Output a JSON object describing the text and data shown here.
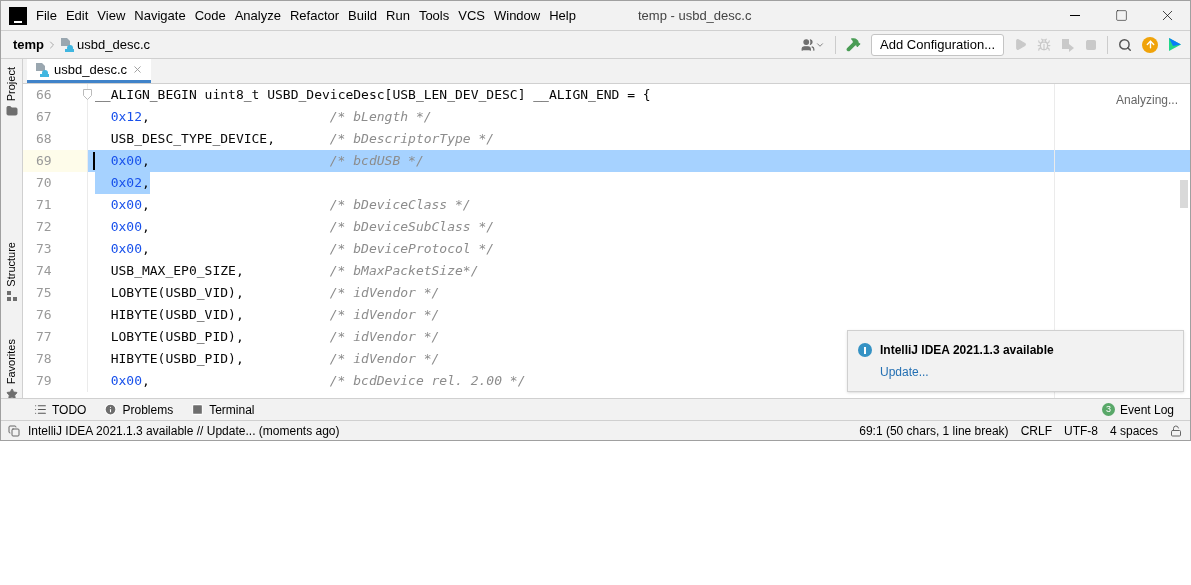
{
  "window": {
    "title": "temp - usbd_desc.c"
  },
  "menu": [
    "File",
    "Edit",
    "View",
    "Navigate",
    "Code",
    "Analyze",
    "Refactor",
    "Build",
    "Run",
    "Tools",
    "VCS",
    "Window",
    "Help"
  ],
  "breadcrumb": [
    "temp",
    "usbd_desc.c"
  ],
  "toolbar": {
    "config_button": "Add Configuration..."
  },
  "side_tabs": [
    {
      "label": "Project",
      "kind": "folder"
    },
    {
      "label": "Structure",
      "kind": "structure"
    },
    {
      "label": "Favorites",
      "kind": "star"
    }
  ],
  "editor_tabs": [
    {
      "label": "usbd_desc.c",
      "selected": true
    }
  ],
  "editor": {
    "status": "Analyzing...",
    "lines": [
      {
        "number": "66",
        "indented": false,
        "current": false,
        "selected": false,
        "fold": true,
        "tokens": [
          {
            "kind": "plain",
            "text": "__ALIGN_BEGIN uint8_t USBD_DeviceDesc[USB_LEN_DEV_DESC] __ALIGN_END = {"
          }
        ]
      },
      {
        "number": "67",
        "indented": true,
        "current": false,
        "selected": false,
        "fold": false,
        "tokens": [
          {
            "kind": "number",
            "text": "0x12"
          },
          {
            "kind": "plain",
            "text": ","
          },
          {
            "kind": "comment",
            "text": "/* bLength */"
          }
        ]
      },
      {
        "number": "68",
        "indented": true,
        "current": false,
        "selected": false,
        "fold": false,
        "tokens": [
          {
            "kind": "plain",
            "text": "USB_DESC_TYPE_DEVICE,"
          },
          {
            "kind": "comment",
            "text": "/* bDescriptorType */"
          }
        ]
      },
      {
        "number": "69",
        "indented": true,
        "current": true,
        "selected": true,
        "fold": false,
        "tokens": [
          {
            "kind": "number",
            "text": "0x00"
          },
          {
            "kind": "plain",
            "text": ","
          },
          {
            "kind": "comment",
            "text": "/* bcdUSB */"
          }
        ]
      },
      {
        "number": "70",
        "indented": true,
        "current": false,
        "selected": true,
        "fold": false,
        "tokens": [
          {
            "kind": "number",
            "text": "0x02"
          },
          {
            "kind": "plain",
            "text": ","
          }
        ]
      },
      {
        "number": "71",
        "indented": true,
        "current": false,
        "selected": false,
        "fold": false,
        "tokens": [
          {
            "kind": "number",
            "text": "0x00"
          },
          {
            "kind": "plain",
            "text": ","
          },
          {
            "kind": "comment",
            "text": "/* bDeviceClass */"
          }
        ]
      },
      {
        "number": "72",
        "indented": true,
        "current": false,
        "selected": false,
        "fold": false,
        "tokens": [
          {
            "kind": "number",
            "text": "0x00"
          },
          {
            "kind": "plain",
            "text": ","
          },
          {
            "kind": "comment",
            "text": "/* bDeviceSubClass */"
          }
        ]
      },
      {
        "number": "73",
        "indented": true,
        "current": false,
        "selected": false,
        "fold": false,
        "tokens": [
          {
            "kind": "number",
            "text": "0x00"
          },
          {
            "kind": "plain",
            "text": ","
          },
          {
            "kind": "comment",
            "text": "/* bDeviceProtocol */"
          }
        ]
      },
      {
        "number": "74",
        "indented": true,
        "current": false,
        "selected": false,
        "fold": false,
        "tokens": [
          {
            "kind": "plain",
            "text": "USB_MAX_EP0_SIZE,"
          },
          {
            "kind": "comment",
            "text": "/* bMaxPacketSize*/"
          }
        ]
      },
      {
        "number": "75",
        "indented": true,
        "current": false,
        "selected": false,
        "fold": false,
        "tokens": [
          {
            "kind": "plain",
            "text": "LOBYTE(USBD_VID),"
          },
          {
            "kind": "comment",
            "text": "/* idVendor */"
          }
        ]
      },
      {
        "number": "76",
        "indented": true,
        "current": false,
        "selected": false,
        "fold": false,
        "tokens": [
          {
            "kind": "plain",
            "text": "HIBYTE(USBD_VID),"
          },
          {
            "kind": "comment",
            "text": "/* idVendor */"
          }
        ]
      },
      {
        "number": "77",
        "indented": true,
        "current": false,
        "selected": false,
        "fold": false,
        "tokens": [
          {
            "kind": "plain",
            "text": "LOBYTE(USBD_PID),"
          },
          {
            "kind": "comment",
            "text": "/* idVendor */"
          }
        ]
      },
      {
        "number": "78",
        "indented": true,
        "current": false,
        "selected": false,
        "fold": false,
        "tokens": [
          {
            "kind": "plain",
            "text": "HIBYTE(USBD_PID),"
          },
          {
            "kind": "comment",
            "text": "/* idVendor */"
          }
        ]
      },
      {
        "number": "79",
        "indented": true,
        "current": false,
        "selected": false,
        "fold": false,
        "tokens": [
          {
            "kind": "number",
            "text": "0x00"
          },
          {
            "kind": "plain",
            "text": ","
          },
          {
            "kind": "comment",
            "text": "/* bcdDevice rel. 2.00 */"
          }
        ]
      }
    ]
  },
  "notification": {
    "title": "IntelliJ IDEA 2021.1.3 available",
    "link": "Update..."
  },
  "tool_windows": [
    {
      "label": "TODO",
      "kind": "list"
    },
    {
      "label": "Problems",
      "kind": "problems"
    },
    {
      "label": "Terminal",
      "kind": "terminal"
    }
  ],
  "event_log": {
    "label": "Event Log",
    "count": "3"
  },
  "status_bar": {
    "message": "IntelliJ IDEA 2021.1.3 available // Update... (moments ago)",
    "position": "69:1 (50 chars, 1 line break)",
    "line_separator": "CRLF",
    "encoding": "UTF-8",
    "indent": "4 spaces"
  }
}
